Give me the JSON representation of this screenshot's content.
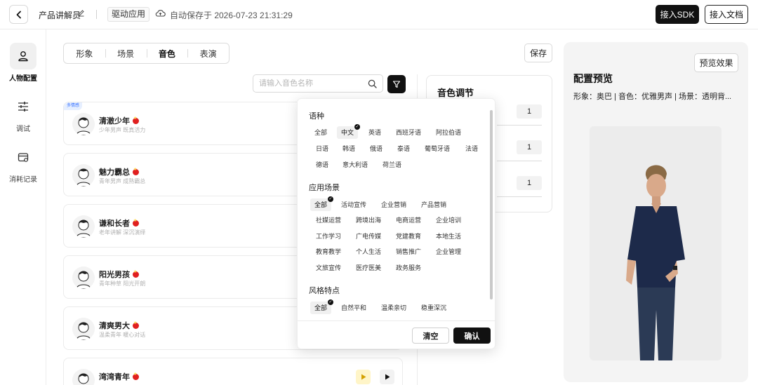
{
  "header": {
    "project_name": "产品讲解员",
    "drive_label": "驱动应用",
    "autosave_text": "自动保存于 2026-07-23 21:31:29",
    "sdk_label": "接入SDK",
    "doc_label": "接入文档"
  },
  "sidebar": {
    "items": [
      {
        "label": "人物配置",
        "icon": "person-icon",
        "active": true
      },
      {
        "label": "调试",
        "icon": "sliders-icon",
        "active": false
      },
      {
        "label": "消耗记录",
        "icon": "wallet-icon",
        "active": false
      }
    ]
  },
  "tabs": {
    "items": [
      "形象",
      "场景",
      "音色",
      "表演"
    ],
    "active": "音色"
  },
  "save_label": "保存",
  "search": {
    "placeholder": "请输入音色名称"
  },
  "voices": [
    {
      "name": "清澈少年",
      "desc": "少年男声 既真活力",
      "badge": "多情感"
    },
    {
      "name": "魅力霸总",
      "desc": "青年男声 成熟霸总",
      "badge": ""
    },
    {
      "name": "谦和长者",
      "desc": "老年讲解 深沉演绎",
      "badge": ""
    },
    {
      "name": "阳光男孩",
      "desc": "青年种草 阳光开朗",
      "badge": ""
    },
    {
      "name": "清爽男大",
      "desc": "温柔青年 暖心对话",
      "badge": ""
    },
    {
      "name": "湾湾青年",
      "desc": "",
      "badge": ""
    }
  ],
  "tone_panel": {
    "title": "音色调节",
    "values": [
      "1",
      "1",
      "1"
    ]
  },
  "preview": {
    "button_label": "预览效果",
    "title": "配置预览",
    "summary": "形象：奥巴 | 音色：优雅男声 | 场景：透明背..."
  },
  "filter": {
    "language_title": "语种",
    "languages": [
      "全部",
      "中文",
      "英语",
      "西班牙语",
      "阿拉伯语",
      "日语",
      "韩语",
      "俄语",
      "泰语",
      "葡萄牙语",
      "法语",
      "德语",
      "意大利语",
      "荷兰语"
    ],
    "language_selected": "中文",
    "scene_title": "应用场景",
    "scenes": [
      "全部",
      "活动宣传",
      "企业营销",
      "产品营销",
      "社媒运营",
      "跨境出海",
      "电商运营",
      "企业培训",
      "工作学习",
      "广电传媒",
      "党建教育",
      "本地生活",
      "教育教学",
      "个人生活",
      "销售推广",
      "企业管理",
      "文旅宣传",
      "医疗医美",
      "政务服务"
    ],
    "scene_selected": "全部",
    "style_title": "风格特点",
    "styles": [
      "全部",
      "自然平和",
      "温柔亲切",
      "稳重深沉"
    ],
    "style_selected": "全部",
    "clear_label": "清空",
    "confirm_label": "确认"
  }
}
